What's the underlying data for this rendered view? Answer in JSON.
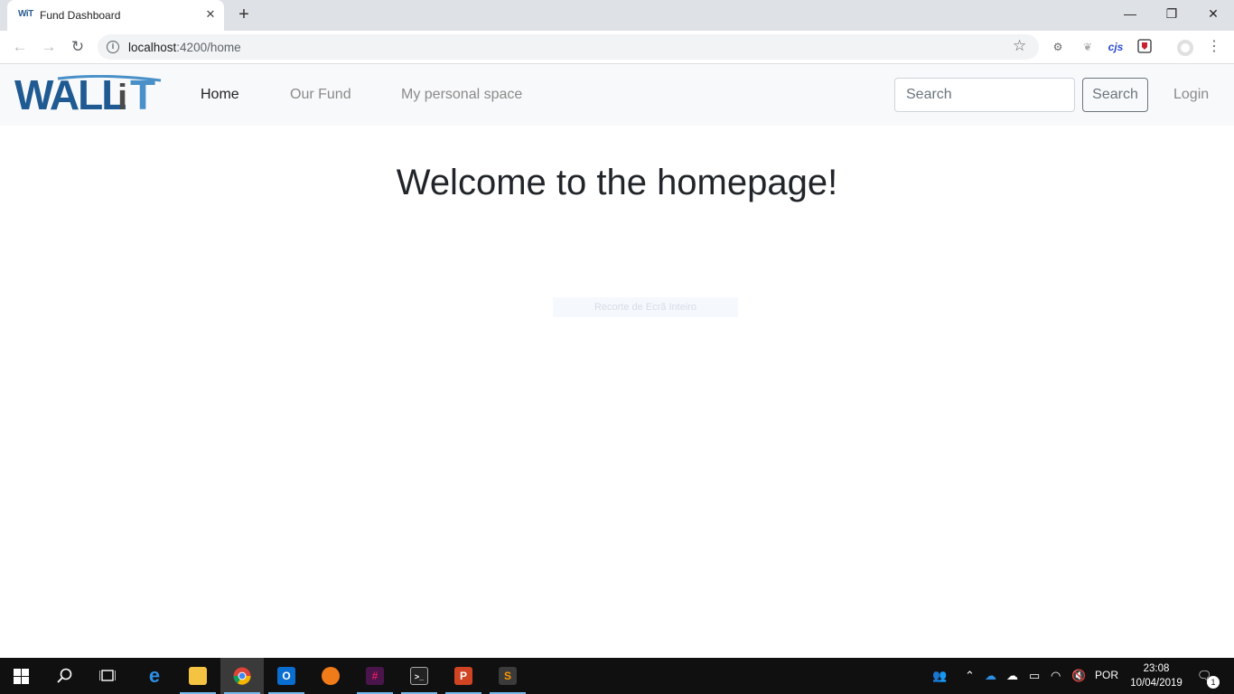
{
  "browser": {
    "tab_title": "Fund Dashboard",
    "tab_favicon_text": "WiT",
    "url_host": "localhost",
    "url_rest": ":4200/home",
    "extensions": [
      "puzzle-gear-icon",
      "leaf-icon",
      "cjs",
      "shield-icon"
    ]
  },
  "navbar": {
    "brand": "WALLiT",
    "links": [
      "Home",
      "Our Fund",
      "My personal space"
    ],
    "search_placeholder": "Search",
    "search_button": "Search",
    "login": "Login"
  },
  "main": {
    "heading": "Welcome to the homepage!",
    "ghost_text": "Recorte de Ecrã Inteiro"
  },
  "taskbar": {
    "language": "POR",
    "time": "23:08",
    "date": "10/04/2019",
    "notifications": "1"
  },
  "colors": {
    "brand_blue": "#1f5a92",
    "brand_light": "#4a90c8"
  }
}
